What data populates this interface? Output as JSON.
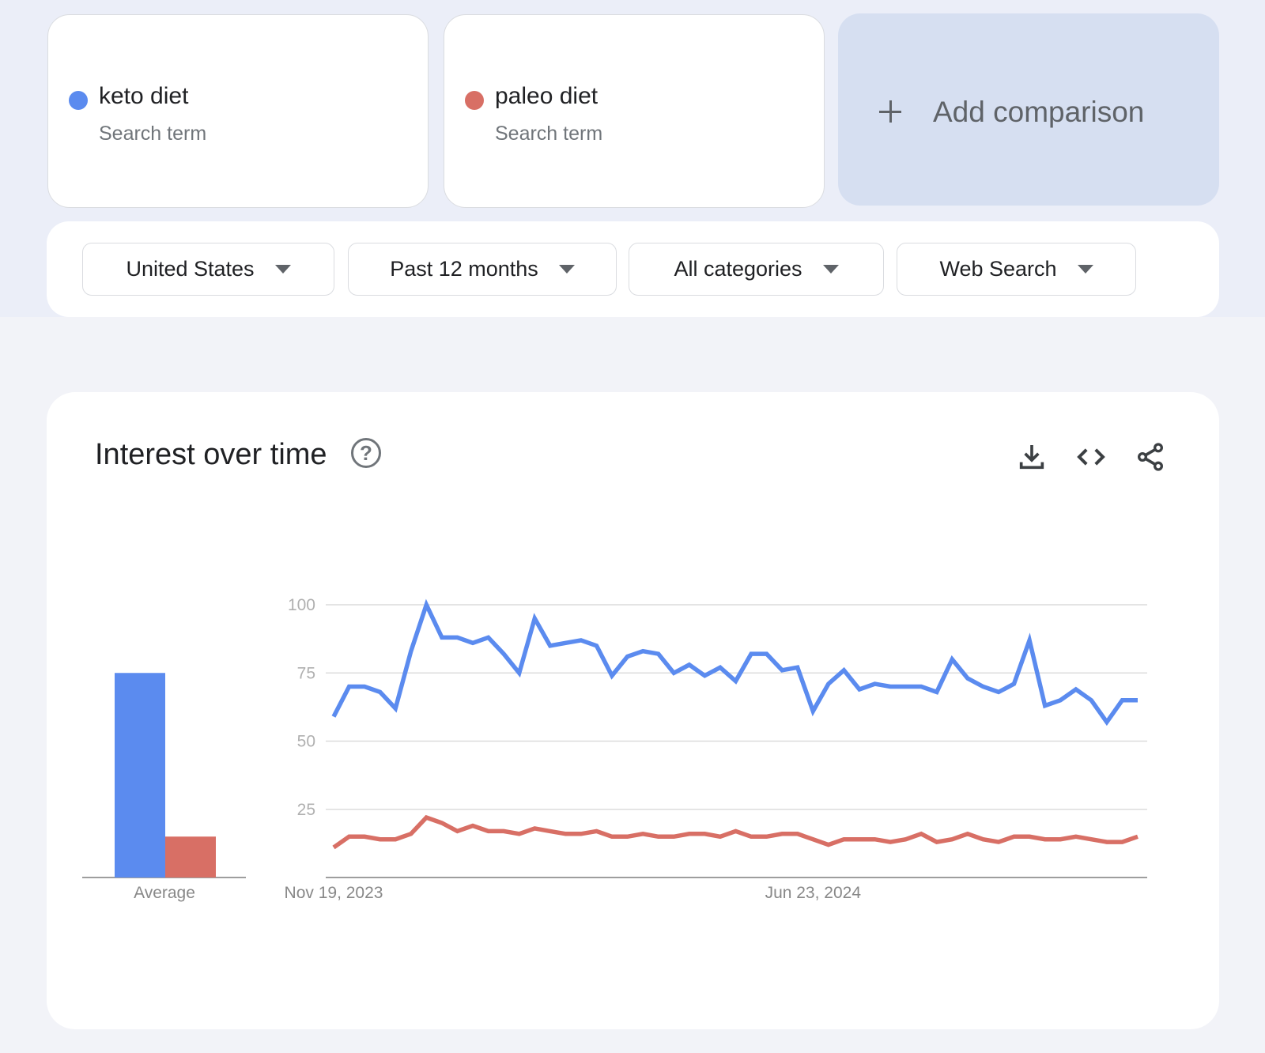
{
  "terms": [
    {
      "label": "keto diet",
      "sublabel": "Search term",
      "color": "#5b8bef"
    },
    {
      "label": "paleo diet",
      "sublabel": "Search term",
      "color": "#d86f65"
    }
  ],
  "add_comparison": {
    "label": "Add comparison",
    "icon": "plus-icon"
  },
  "filters": [
    {
      "label": "United States",
      "icon": "caret-down-icon"
    },
    {
      "label": "Past 12 months",
      "icon": "caret-down-icon"
    },
    {
      "label": "All categories",
      "icon": "caret-down-icon"
    },
    {
      "label": "Web Search",
      "icon": "caret-down-icon"
    }
  ],
  "panel": {
    "title": "Interest over time",
    "help_icon_glyph": "?",
    "actions": [
      "download-icon",
      "embed-code-icon",
      "share-icon"
    ]
  },
  "chart_data": [
    {
      "type": "bar",
      "title": "Average",
      "categories": [
        "Average"
      ],
      "xlabel": "Average",
      "series": [
        {
          "name": "keto diet",
          "color": "#5b8bef",
          "values": [
            75
          ]
        },
        {
          "name": "paleo diet",
          "color": "#d86f65",
          "values": [
            15
          ]
        }
      ],
      "ylim": [
        0,
        100
      ]
    },
    {
      "type": "line",
      "title": "Interest over time",
      "xlabel": "",
      "ylabel": "",
      "ylim": [
        0,
        100
      ],
      "yticks": [
        25,
        50,
        75,
        100
      ],
      "grid": true,
      "x_tick_labels": [
        {
          "label": "Nov 19, 2023",
          "index": 0
        },
        {
          "label": "Jun 23, 2024",
          "index": 31
        }
      ],
      "x_start": "Nov 19, 2023",
      "x_interval": "weekly",
      "series": [
        {
          "name": "keto diet",
          "color": "#5b8bef",
          "values": [
            59,
            70,
            70,
            68,
            62,
            83,
            100,
            88,
            88,
            86,
            88,
            82,
            75,
            95,
            85,
            86,
            87,
            85,
            74,
            81,
            83,
            82,
            75,
            78,
            74,
            77,
            72,
            82,
            82,
            76,
            77,
            61,
            71,
            76,
            69,
            71,
            70,
            70,
            70,
            68,
            80,
            73,
            70,
            68,
            71,
            87,
            63,
            65,
            69,
            65,
            57,
            65,
            65
          ]
        },
        {
          "name": "paleo diet",
          "color": "#d86f65",
          "values": [
            11,
            15,
            15,
            14,
            14,
            16,
            22,
            20,
            17,
            19,
            17,
            17,
            16,
            18,
            17,
            16,
            16,
            17,
            15,
            15,
            16,
            15,
            15,
            16,
            16,
            15,
            17,
            15,
            15,
            16,
            16,
            14,
            12,
            14,
            14,
            14,
            13,
            14,
            16,
            13,
            14,
            16,
            14,
            13,
            15,
            15,
            14,
            14,
            15,
            14,
            13,
            13,
            15
          ]
        }
      ]
    }
  ]
}
